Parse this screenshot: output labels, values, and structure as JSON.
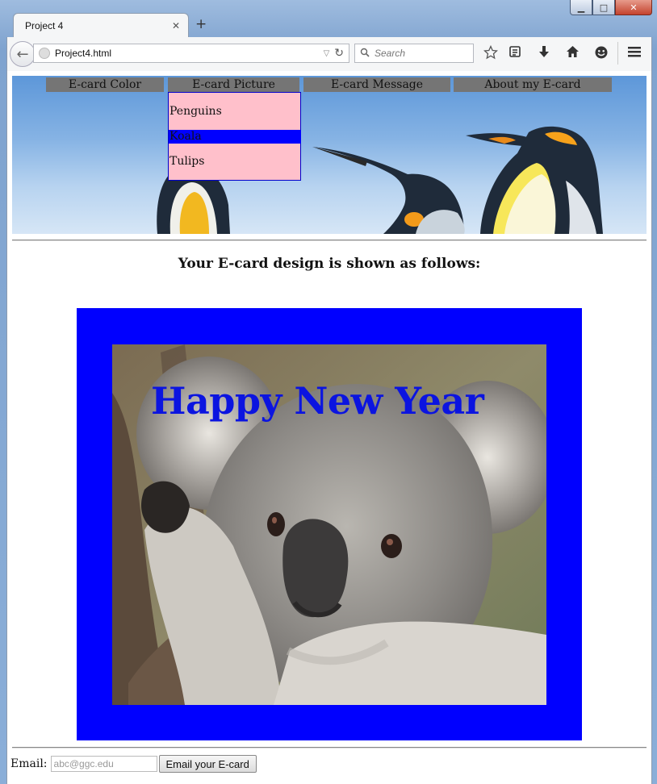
{
  "window": {
    "minimize_glyph": "▁",
    "maximize_glyph": "□",
    "close_glyph": "✕"
  },
  "tab": {
    "title": "Project 4",
    "close_glyph": "✕",
    "new_tab_glyph": "+"
  },
  "navbar": {
    "back_glyph": "←",
    "url": "Project4.html",
    "url_dropdown_glyph": "▽",
    "reload_glyph": "↻",
    "search_placeholder": "Search",
    "search_icon": "search-icon",
    "toolbar_icons": [
      "star-icon",
      "reading-list-icon",
      "download-icon",
      "home-icon",
      "hello-icon",
      "menu-icon"
    ]
  },
  "page": {
    "menu": [
      "E-card Color",
      "E-card Picture",
      "E-card Message",
      "About my E-card"
    ],
    "picture_options": [
      "Penguins",
      "Koala",
      "Tulips"
    ],
    "picture_selected": "Koala",
    "heading": "Your E-card design is shown as follows:",
    "card": {
      "border_color": "#0000ff",
      "message": "Happy New Year",
      "message_color": "#0b14e0"
    },
    "email": {
      "label": "Email:",
      "placeholder": "abc@ggc.edu",
      "button_label": "Email your E-card"
    }
  }
}
